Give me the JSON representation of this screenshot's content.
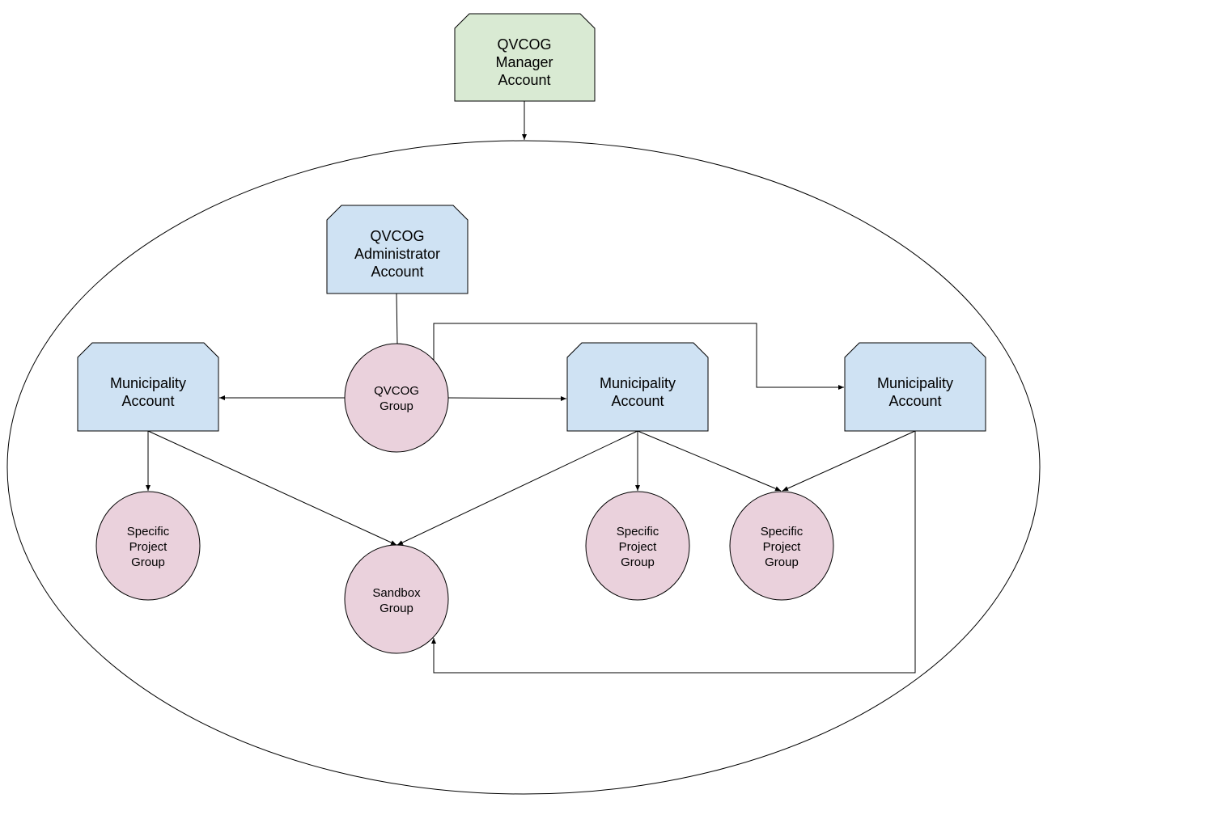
{
  "colors": {
    "manager": "#d9ead3",
    "account": "#cfe2f3",
    "group": "#ead1dc",
    "stroke": "#000000"
  },
  "nodes": {
    "manager": [
      "QVCOG",
      "Manager",
      "Account"
    ],
    "admin": [
      "QVCOG",
      "Administrator",
      "Account"
    ],
    "muni1": [
      "Municipality",
      "Account"
    ],
    "muni2": [
      "Municipality",
      "Account"
    ],
    "muni3": [
      "Municipality",
      "Account"
    ],
    "qvcog_group": [
      "QVCOG",
      "Group"
    ],
    "specific1": [
      "Specific",
      "Project",
      "Group"
    ],
    "specific2": [
      "Specific",
      "Project",
      "Group"
    ],
    "specific3": [
      "Specific",
      "Project",
      "Group"
    ],
    "sandbox": [
      "Sandbox",
      "Group"
    ]
  },
  "edges": [
    {
      "from": "manager",
      "to": "ellipse",
      "arrow": true
    },
    {
      "from": "admin",
      "to": "qvcog_group",
      "arrow": false
    },
    {
      "from": "qvcog_group",
      "to": "muni1",
      "arrow": true
    },
    {
      "from": "qvcog_group",
      "to": "muni2",
      "arrow": true
    },
    {
      "from": "qvcog_group",
      "to": "muni3",
      "arrow": true
    },
    {
      "from": "muni1",
      "to": "specific1",
      "arrow": true
    },
    {
      "from": "muni1",
      "to": "sandbox",
      "arrow": true
    },
    {
      "from": "muni2",
      "to": "sandbox",
      "arrow": true
    },
    {
      "from": "muni2",
      "to": "specific2",
      "arrow": true
    },
    {
      "from": "muni2",
      "to": "specific3",
      "arrow": true
    },
    {
      "from": "muni3",
      "to": "specific3",
      "arrow": true
    },
    {
      "from": "muni3",
      "to": "sandbox",
      "arrow": true
    }
  ]
}
